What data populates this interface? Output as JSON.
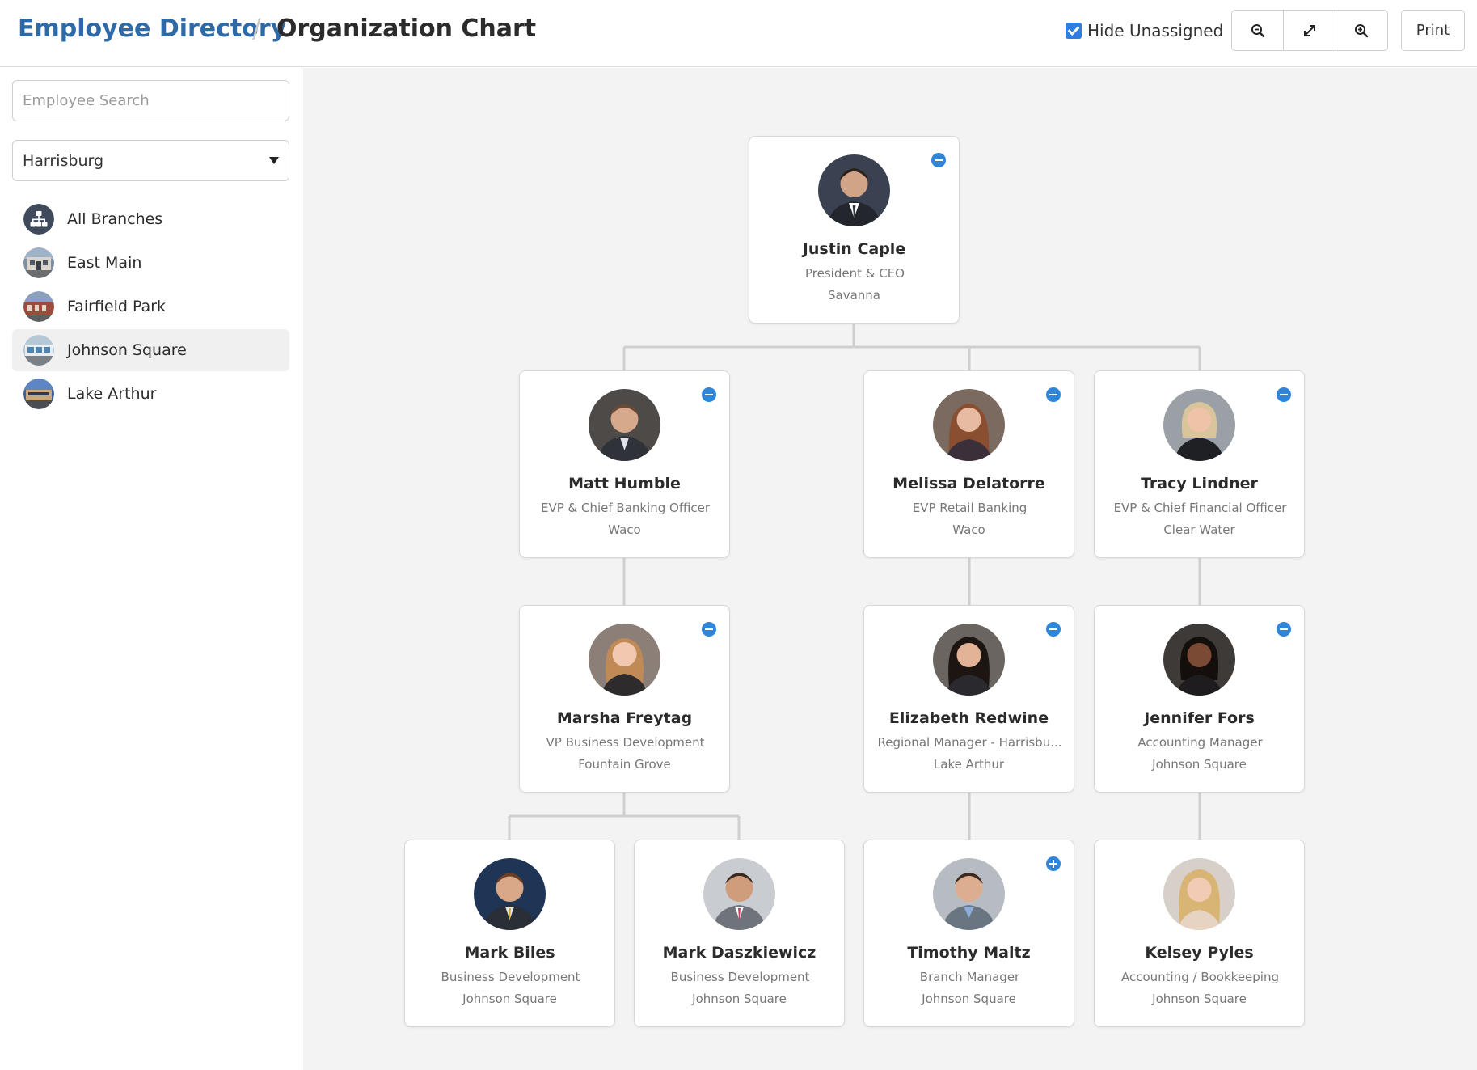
{
  "header": {
    "breadcrumb_root": "Employee Directory",
    "breadcrumb_sep": "/",
    "page_title": "Organization Chart",
    "hide_unassigned_label": "Hide Unassigned",
    "hide_unassigned_checked": true,
    "zoom_out_icon": "zoom-out-icon",
    "fit_icon": "expand-icon",
    "zoom_in_icon": "zoom-in-icon",
    "print_label": "Print"
  },
  "sidebar": {
    "search_placeholder": "Employee Search",
    "region_selected": "Harrisburg",
    "branches": [
      {
        "label": "All Branches",
        "icon": "org-chart-icon",
        "active": false
      },
      {
        "label": "East Main",
        "icon": "branch-photo",
        "active": false
      },
      {
        "label": "Fairfield Park",
        "icon": "branch-photo",
        "active": false
      },
      {
        "label": "Johnson Square",
        "icon": "branch-photo",
        "active": true
      },
      {
        "label": "Lake Arthur",
        "icon": "branch-photo",
        "active": false
      }
    ]
  },
  "org": {
    "ceo": {
      "name": "Justin Caple",
      "title": "President & CEO",
      "branch": "Savanna",
      "toggle": "collapse"
    },
    "matt": {
      "name": "Matt Humble",
      "title": "EVP & Chief Banking Officer",
      "branch": "Waco",
      "toggle": "collapse"
    },
    "melissa": {
      "name": "Melissa Delatorre",
      "title": "EVP Retail Banking",
      "branch": "Waco",
      "toggle": "collapse"
    },
    "tracy": {
      "name": "Tracy Lindner",
      "title": "EVP & Chief Financial Officer",
      "branch": "Clear Water",
      "toggle": "collapse"
    },
    "marsha": {
      "name": "Marsha Freytag",
      "title": "VP Business Development",
      "branch": "Fountain Grove",
      "toggle": "collapse"
    },
    "elizabeth": {
      "name": "Elizabeth Redwine",
      "title": "Regional Manager - Harrisbu...",
      "branch": "Lake Arthur",
      "toggle": "collapse"
    },
    "jennifer": {
      "name": "Jennifer Fors",
      "title": "Accounting Manager",
      "branch": "Johnson Square",
      "toggle": "collapse"
    },
    "markb": {
      "name": "Mark Biles",
      "title": "Business Development",
      "branch": "Johnson Square",
      "toggle": "none"
    },
    "markd": {
      "name": "Mark Daszkiewicz",
      "title": "Business Development",
      "branch": "Johnson Square",
      "toggle": "none"
    },
    "timothy": {
      "name": "Timothy Maltz",
      "title": "Branch Manager",
      "branch": "Johnson Square",
      "toggle": "expand"
    },
    "kelsey": {
      "name": "Kelsey Pyles",
      "title": "Accounting / Bookkeeping",
      "branch": "Johnson Square",
      "toggle": "none"
    }
  },
  "colors": {
    "brand": "#2f6aa8",
    "toggle": "#2f86d8",
    "canvas_bg": "#f3f3f3",
    "connector": "#cfcfcf"
  }
}
